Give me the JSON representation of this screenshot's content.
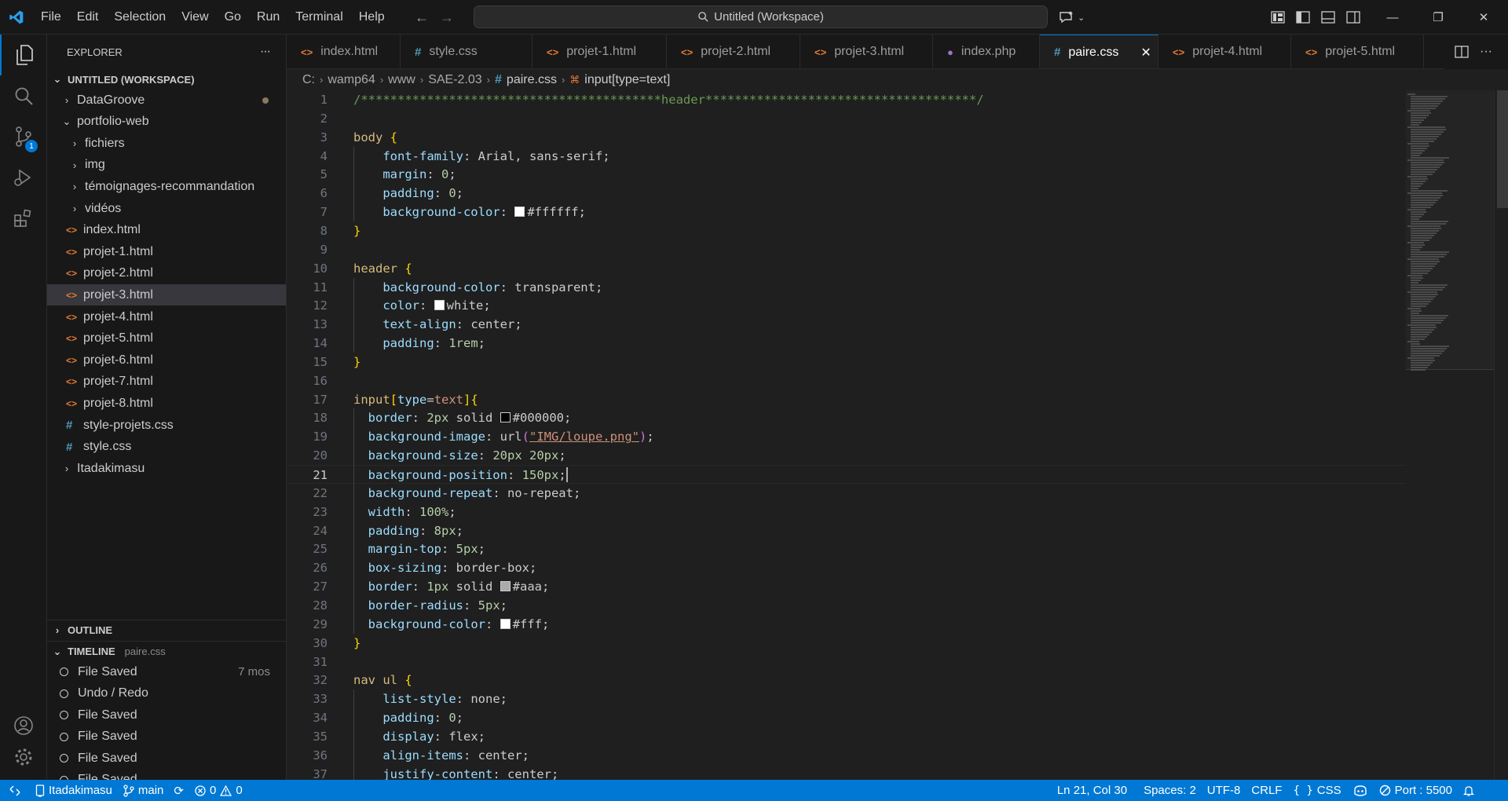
{
  "titlebar": {
    "menu": [
      "File",
      "Edit",
      "Selection",
      "View",
      "Go",
      "Run",
      "Terminal",
      "Help"
    ],
    "command_center": "Untitled (Workspace)"
  },
  "activity": {
    "scm_badge": "1"
  },
  "explorer": {
    "header": "EXPLORER",
    "more": "···",
    "workspace": "UNTITLED (WORKSPACE)",
    "items": [
      {
        "label": "DataGroove",
        "kind": "folder",
        "level": 0,
        "expanded": false,
        "modified": true
      },
      {
        "label": "portfolio-web",
        "kind": "folder",
        "level": 0,
        "expanded": true
      },
      {
        "label": "fichiers",
        "kind": "folder",
        "level": 1,
        "expanded": false
      },
      {
        "label": "img",
        "kind": "folder",
        "level": 1,
        "expanded": false
      },
      {
        "label": "témoignages-recommandation",
        "kind": "folder",
        "level": 1,
        "expanded": false
      },
      {
        "label": "vidéos",
        "kind": "folder",
        "level": 1,
        "expanded": false
      },
      {
        "label": "index.html",
        "kind": "html",
        "level": 1
      },
      {
        "label": "projet-1.html",
        "kind": "html",
        "level": 1
      },
      {
        "label": "projet-2.html",
        "kind": "html",
        "level": 1
      },
      {
        "label": "projet-3.html",
        "kind": "html",
        "level": 1,
        "selected": true
      },
      {
        "label": "projet-4.html",
        "kind": "html",
        "level": 1
      },
      {
        "label": "projet-5.html",
        "kind": "html",
        "level": 1
      },
      {
        "label": "projet-6.html",
        "kind": "html",
        "level": 1
      },
      {
        "label": "projet-7.html",
        "kind": "html",
        "level": 1
      },
      {
        "label": "projet-8.html",
        "kind": "html",
        "level": 1
      },
      {
        "label": "style-projets.css",
        "kind": "css",
        "level": 1
      },
      {
        "label": "style.css",
        "kind": "css",
        "level": 1
      },
      {
        "label": "Itadakimasu",
        "kind": "folder",
        "level": 0,
        "expanded": false
      }
    ],
    "outline": "OUTLINE",
    "timeline": "TIMELINE",
    "timeline_file": "paire.css",
    "timeline_items": [
      {
        "label": "File Saved",
        "time": "7 mos"
      },
      {
        "label": "Undo / Redo",
        "time": ""
      },
      {
        "label": "File Saved",
        "time": ""
      },
      {
        "label": "File Saved",
        "time": ""
      },
      {
        "label": "File Saved",
        "time": ""
      },
      {
        "label": "File Saved",
        "time": ""
      }
    ]
  },
  "tabs": [
    {
      "label": "index.html",
      "kind": "html"
    },
    {
      "label": "style.css",
      "kind": "css"
    },
    {
      "label": "projet-1.html",
      "kind": "html"
    },
    {
      "label": "projet-2.html",
      "kind": "html"
    },
    {
      "label": "projet-3.html",
      "kind": "html"
    },
    {
      "label": "index.php",
      "kind": "php"
    },
    {
      "label": "paire.css",
      "kind": "css",
      "active": true
    },
    {
      "label": "projet-4.html",
      "kind": "html"
    },
    {
      "label": "projet-5.html",
      "kind": "html"
    }
  ],
  "breadcrumb": [
    "C:",
    "wamp64",
    "www",
    "SAE-2.03",
    "paire.css",
    "input[type=text]"
  ],
  "editor": {
    "current_line": 21,
    "lines": [
      [
        {
          "c": "t-comment",
          "t": "/*****************************************header*************************************/"
        }
      ],
      [],
      [
        {
          "c": "t-sel",
          "t": "body "
        },
        {
          "c": "t-brace",
          "t": "{"
        }
      ],
      [
        {
          "c": "",
          "t": "    "
        },
        {
          "c": "t-prop",
          "t": "font-family"
        },
        {
          "c": "t-val",
          "t": ": Arial, sans-serif;"
        }
      ],
      [
        {
          "c": "",
          "t": "    "
        },
        {
          "c": "t-prop",
          "t": "margin"
        },
        {
          "c": "t-val",
          "t": ": "
        },
        {
          "c": "t-num",
          "t": "0"
        },
        {
          "c": "t-val",
          "t": ";"
        }
      ],
      [
        {
          "c": "",
          "t": "    "
        },
        {
          "c": "t-prop",
          "t": "padding"
        },
        {
          "c": "t-val",
          "t": ": "
        },
        {
          "c": "t-num",
          "t": "0"
        },
        {
          "c": "t-val",
          "t": ";"
        }
      ],
      [
        {
          "c": "",
          "t": "    "
        },
        {
          "c": "t-prop",
          "t": "background-color"
        },
        {
          "c": "t-val",
          "t": ": "
        },
        {
          "sw": "#ffffff"
        },
        {
          "c": "t-val",
          "t": "#ffffff;"
        }
      ],
      [
        {
          "c": "t-brace",
          "t": "}"
        }
      ],
      [],
      [
        {
          "c": "t-sel",
          "t": "header "
        },
        {
          "c": "t-brace",
          "t": "{"
        }
      ],
      [
        {
          "c": "",
          "t": "    "
        },
        {
          "c": "t-prop",
          "t": "background-color"
        },
        {
          "c": "t-val",
          "t": ": transparent;"
        }
      ],
      [
        {
          "c": "",
          "t": "    "
        },
        {
          "c": "t-prop",
          "t": "color"
        },
        {
          "c": "t-val",
          "t": ": "
        },
        {
          "sw": "#ffffff"
        },
        {
          "c": "t-val",
          "t": "white;"
        }
      ],
      [
        {
          "c": "",
          "t": "    "
        },
        {
          "c": "t-prop",
          "t": "text-align"
        },
        {
          "c": "t-val",
          "t": ": center;"
        }
      ],
      [
        {
          "c": "",
          "t": "    "
        },
        {
          "c": "t-prop",
          "t": "padding"
        },
        {
          "c": "t-val",
          "t": ": "
        },
        {
          "c": "t-num",
          "t": "1rem"
        },
        {
          "c": "t-val",
          "t": ";"
        }
      ],
      [
        {
          "c": "t-brace",
          "t": "}"
        }
      ],
      [],
      [
        {
          "c": "t-sel",
          "t": "input"
        },
        {
          "c": "t-brace",
          "t": "["
        },
        {
          "c": "t-prop",
          "t": "type"
        },
        {
          "c": "t-val",
          "t": "="
        },
        {
          "c": "t-str-plain",
          "t": "text"
        },
        {
          "c": "t-brace",
          "t": "]{"
        }
      ],
      [
        {
          "c": "",
          "t": "  "
        },
        {
          "c": "t-prop",
          "t": "border"
        },
        {
          "c": "t-val",
          "t": ": "
        },
        {
          "c": "t-num",
          "t": "2px"
        },
        {
          "c": "t-val",
          "t": " solid "
        },
        {
          "sw": "#000000"
        },
        {
          "c": "t-val",
          "t": "#000000;"
        }
      ],
      [
        {
          "c": "",
          "t": "  "
        },
        {
          "c": "t-prop",
          "t": "background-image"
        },
        {
          "c": "t-val",
          "t": ": url"
        },
        {
          "c": "t-paren",
          "t": "("
        },
        {
          "c": "t-str",
          "t": "\"IMG/loupe.png\""
        },
        {
          "c": "t-paren",
          "t": ")"
        },
        {
          "c": "t-val",
          "t": ";"
        }
      ],
      [
        {
          "c": "",
          "t": "  "
        },
        {
          "c": "t-prop",
          "t": "background-size"
        },
        {
          "c": "t-val",
          "t": ": "
        },
        {
          "c": "t-num",
          "t": "20px"
        },
        {
          "c": "t-val",
          "t": " "
        },
        {
          "c": "t-num",
          "t": "20px"
        },
        {
          "c": "t-val",
          "t": ";"
        }
      ],
      [
        {
          "c": "",
          "t": "  "
        },
        {
          "c": "t-prop",
          "t": "background-position"
        },
        {
          "c": "t-val",
          "t": ": "
        },
        {
          "c": "t-num",
          "t": "150px"
        },
        {
          "c": "t-val",
          "t": ";"
        },
        {
          "cursor": true
        }
      ],
      [
        {
          "c": "",
          "t": "  "
        },
        {
          "c": "t-prop",
          "t": "background-repeat"
        },
        {
          "c": "t-val",
          "t": ": no-repeat;"
        }
      ],
      [
        {
          "c": "",
          "t": "  "
        },
        {
          "c": "t-prop",
          "t": "width"
        },
        {
          "c": "t-val",
          "t": ": "
        },
        {
          "c": "t-num",
          "t": "100%"
        },
        {
          "c": "t-val",
          "t": ";"
        }
      ],
      [
        {
          "c": "",
          "t": "  "
        },
        {
          "c": "t-prop",
          "t": "padding"
        },
        {
          "c": "t-val",
          "t": ": "
        },
        {
          "c": "t-num",
          "t": "8px"
        },
        {
          "c": "t-val",
          "t": ";"
        }
      ],
      [
        {
          "c": "",
          "t": "  "
        },
        {
          "c": "t-prop",
          "t": "margin-top"
        },
        {
          "c": "t-val",
          "t": ": "
        },
        {
          "c": "t-num",
          "t": "5px"
        },
        {
          "c": "t-val",
          "t": ";"
        }
      ],
      [
        {
          "c": "",
          "t": "  "
        },
        {
          "c": "t-prop",
          "t": "box-sizing"
        },
        {
          "c": "t-val",
          "t": ": border-box;"
        }
      ],
      [
        {
          "c": "",
          "t": "  "
        },
        {
          "c": "t-prop",
          "t": "border"
        },
        {
          "c": "t-val",
          "t": ": "
        },
        {
          "c": "t-num",
          "t": "1px"
        },
        {
          "c": "t-val",
          "t": " solid "
        },
        {
          "sw": "#aaaaaa"
        },
        {
          "c": "t-val",
          "t": "#aaa;"
        }
      ],
      [
        {
          "c": "",
          "t": "  "
        },
        {
          "c": "t-prop",
          "t": "border-radius"
        },
        {
          "c": "t-val",
          "t": ": "
        },
        {
          "c": "t-num",
          "t": "5px"
        },
        {
          "c": "t-val",
          "t": ";"
        }
      ],
      [
        {
          "c": "",
          "t": "  "
        },
        {
          "c": "t-prop",
          "t": "background-color"
        },
        {
          "c": "t-val",
          "t": ": "
        },
        {
          "sw": "#ffffff"
        },
        {
          "c": "t-val",
          "t": "#fff;"
        }
      ],
      [
        {
          "c": "t-brace",
          "t": "}"
        }
      ],
      [],
      [
        {
          "c": "t-sel",
          "t": "nav ul "
        },
        {
          "c": "t-brace",
          "t": "{"
        }
      ],
      [
        {
          "c": "",
          "t": "    "
        },
        {
          "c": "t-prop",
          "t": "list-style"
        },
        {
          "c": "t-val",
          "t": ": none;"
        }
      ],
      [
        {
          "c": "",
          "t": "    "
        },
        {
          "c": "t-prop",
          "t": "padding"
        },
        {
          "c": "t-val",
          "t": ": "
        },
        {
          "c": "t-num",
          "t": "0"
        },
        {
          "c": "t-val",
          "t": ";"
        }
      ],
      [
        {
          "c": "",
          "t": "    "
        },
        {
          "c": "t-prop",
          "t": "display"
        },
        {
          "c": "t-val",
          "t": ": flex;"
        }
      ],
      [
        {
          "c": "",
          "t": "    "
        },
        {
          "c": "t-prop",
          "t": "align-items"
        },
        {
          "c": "t-val",
          "t": ": center;"
        }
      ],
      [
        {
          "c": "",
          "t": "    "
        },
        {
          "c": "t-prop",
          "t": "justify-content"
        },
        {
          "c": "t-val",
          "t": ": center;"
        }
      ]
    ]
  },
  "statusbar": {
    "workspace": "Itadakimasu",
    "branch": "main",
    "errors": "0",
    "warnings": "0",
    "position": "Ln 21, Col 30",
    "spaces": "Spaces: 2",
    "encoding": "UTF-8",
    "eol": "CRLF",
    "language": "CSS",
    "port": "Port : 5500"
  },
  "colors": {
    "accent": "#0078d4",
    "status_bar": "#0078d4",
    "editor_bg": "#1f1f1f"
  }
}
